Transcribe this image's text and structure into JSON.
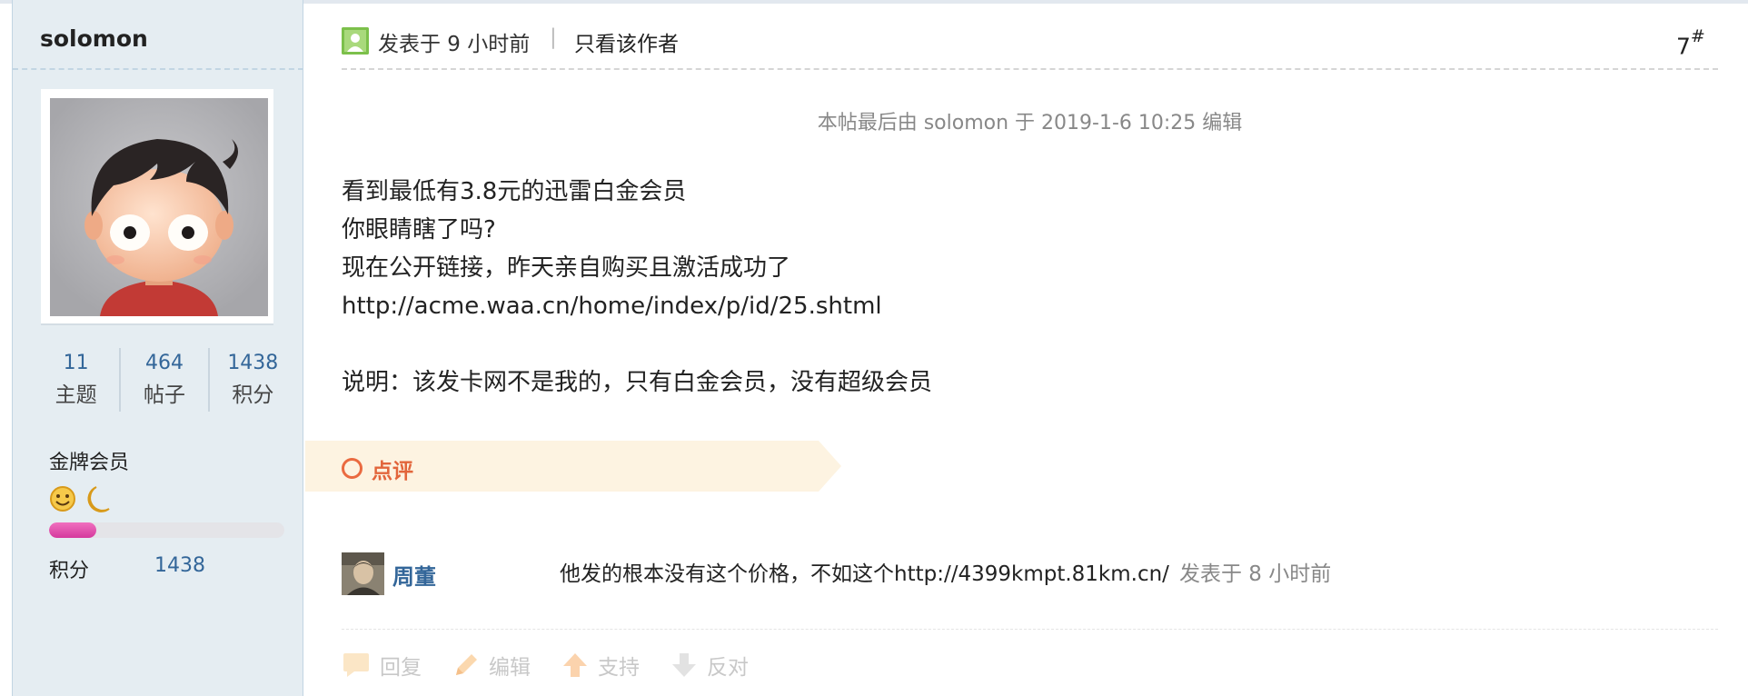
{
  "sidebar": {
    "username": "solomon",
    "stats": [
      {
        "value": "11",
        "label": "主题"
      },
      {
        "value": "464",
        "label": "帖子"
      },
      {
        "value": "1438",
        "label": "积分"
      }
    ],
    "member_level": "金牌会员",
    "level_icons": [
      "smiley-icon",
      "moon-icon"
    ],
    "level_progress_percent": 20,
    "points_label": "积分",
    "points_value": "1438"
  },
  "post": {
    "posted_time": "发表于 9 小时前",
    "separator": "|",
    "only_author_link": "只看该作者",
    "floor_number": "7",
    "floor_suffix": "#",
    "edit_note": "本帖最后由 solomon 于 2019-1-6 10:25 编辑",
    "body_lines": [
      "看到最低有3.8元的迅雷白金会员",
      "你眼睛瞎了吗?",
      "现在公开链接，昨天亲自购买且激活成功了",
      "http://acme.waa.cn/home/index/p/id/25.shtml"
    ],
    "body_note": "说明：该发卡网不是我的，只有白金会员，没有超级会员"
  },
  "comments": {
    "label": "点评",
    "items": [
      {
        "user": "周董",
        "text": "他发的根本没有这个价格，不如这个http://4399kmpt.81km.cn/",
        "time": "发表于 8 小时前"
      }
    ]
  },
  "actions": [
    {
      "icon": "reply-icon",
      "label": "回复"
    },
    {
      "icon": "edit-icon",
      "label": "编辑"
    },
    {
      "icon": "support-icon",
      "label": "支持"
    },
    {
      "icon": "oppose-icon",
      "label": "反对"
    }
  ],
  "colors": {
    "sidebar_bg": "#e5edf2",
    "link_blue": "#336699",
    "comment_accent": "#e2653b",
    "banner_bg": "#fdf3e1",
    "progress_pink": "#e04aa9"
  }
}
